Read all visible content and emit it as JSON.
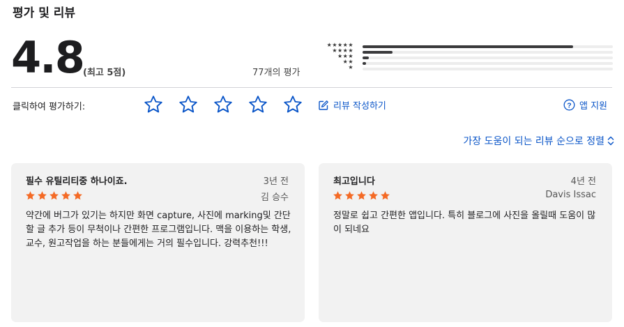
{
  "header": {
    "title": "평가 및 리뷰"
  },
  "rating": {
    "average": "4.8",
    "out_of": "(최고 5점)",
    "count": "77개의 평가",
    "histogram": [
      {
        "stars": "★★★★★",
        "fraction": 0.84
      },
      {
        "stars": "★★★★",
        "fraction": 0.12
      },
      {
        "stars": "★★★",
        "fraction": 0.025
      },
      {
        "stars": "★★",
        "fraction": 0.015
      },
      {
        "stars": "★",
        "fraction": 0.0
      }
    ]
  },
  "rate_bar": {
    "label": "클릭하여 평가하기:",
    "stars": [
      1,
      2,
      3,
      4,
      5
    ],
    "write_review": "리뷰 작성하기",
    "app_support": "앱 지원"
  },
  "sort": {
    "label": "가장 도움이 되는 리뷰 순으로 정렬"
  },
  "reviews": [
    {
      "title": "필수 유틸리티중 하나이죠.",
      "date": "3년 전",
      "author": "김 승수",
      "stars": 5,
      "body": "약간에 버그가 있기는 하지만 화면 capture, 사진에 marking및 간단할 글 추가 등이 무척이나 간편한 프로그램입니다. 맥을 이용하는 학생, 교수, 원고작업을 하는 분들에게는 거의 필수입니다. 강력추천!!!"
    },
    {
      "title": "최고입니다",
      "date": "4년 전",
      "author": "Davis Issac",
      "stars": 5,
      "body": "정말로 쉽고 간편한 앱입니다. 특히 블로그에 사진을 올릴때 도움이 많이 되네요"
    }
  ],
  "colors": {
    "accent": "#0a55c8",
    "review_star": "#f46a25",
    "card_bg": "#f2f2f2",
    "bar_fill": "#3a3a3c",
    "bar_track": "#ededed"
  }
}
